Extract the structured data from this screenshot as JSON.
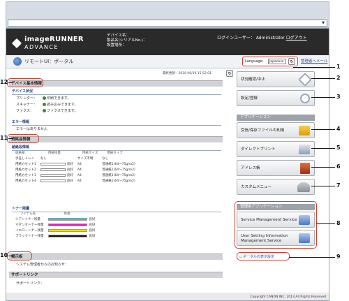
{
  "header": {
    "logo_line1": "imageRUNNER",
    "logo_line2": "ADVANCE",
    "device_name_label": "デバイス名：",
    "serial_label": "製品名(シリアルNo.)：",
    "location_label": "設置場所：",
    "login_user_label": "ログインユーザー：",
    "login_user": "Administrator",
    "logout": "ログアウト"
  },
  "titlebar": {
    "title": "リモートUI：ポータル",
    "language_label": "Language:",
    "language_value": "Japanese",
    "help_link": "管理者へメール"
  },
  "updated": "最終更新：2018 06/19 15:52:01",
  "sections": {
    "device_basic": "デバイス基本情報",
    "device_status": "デバイス状況",
    "status_rows": [
      {
        "label": "プリンター：",
        "value": "印刷できます。"
      },
      {
        "label": "スキャナー：",
        "value": "読み込みできます。"
      },
      {
        "label": "ファクス：",
        "value": "ファクスできます。"
      }
    ],
    "error_title": "エラー情報",
    "error_text": "エラーはありません",
    "consumables": "消耗品情報",
    "paper_title": "給紙段情報",
    "paper_headers": [
      "給紙部",
      "用紙残量",
      "用紙サイズ",
      "用紙タイプ"
    ],
    "paper_rows": [
      {
        "slot": "手差しトレイ",
        "remain": "なし",
        "size": "サイズ不明",
        "type": "なし"
      },
      {
        "slot": "用紙カセット1",
        "remain": "良好",
        "size": "A4",
        "type": "普通紙1(64～75g/m2)"
      },
      {
        "slot": "用紙カセット2",
        "remain": "良好",
        "size": "A4",
        "type": "普通紙1(64～75g/m2)"
      },
      {
        "slot": "用紙カセット3",
        "remain": "良好",
        "size": "A4",
        "type": "普通紙1(64～75g/m2)"
      },
      {
        "slot": "用紙カセット4",
        "remain": "良好",
        "size": "A4",
        "type": "普通紙1(64～75g/m2)"
      }
    ],
    "toner_title": "トナー残量",
    "toner_headers": [
      "アイテム名",
      "残量"
    ],
    "toner_rows": [
      {
        "name": "シアントナー残量",
        "state": "良好",
        "color": "#00d0e8"
      },
      {
        "name": "マゼンタトナー残量",
        "state": "良好",
        "color": "#e020c0"
      },
      {
        "name": "イエロートナー残量",
        "state": "良好",
        "color": "#f0e000"
      },
      {
        "name": "ブラックトナー残量",
        "state": "良好",
        "color": "#111111"
      }
    ],
    "message_board": "掲示板",
    "message_text": "システム管理者からのお知らせ：",
    "support": "サポートリンク",
    "support_text": "サポートリンク："
  },
  "right": {
    "status_button": "状況確認/中止",
    "settings_button": "設定/登録",
    "apps_header": "アプリケーション",
    "app_buttons": [
      "受信/保存ファイルの利用",
      "ダイレクトプリント",
      "アドレス帳",
      "カスタムメニュー"
    ],
    "mgmt_header": "管理用アプリケーション",
    "mgmt_buttons": [
      "Service Management Service",
      "User Setting Information\nManagement Service"
    ],
    "portal_settings": "ポータルの表示設定"
  },
  "callouts": [
    "1",
    "2",
    "3",
    "4",
    "5",
    "6",
    "7",
    "8",
    "9",
    "10",
    "11",
    "12"
  ],
  "footer": "Copyright CANON INC. 2013 All Rights Reserved",
  "colors": {
    "accent_red": "#d04030",
    "header_bg": "#2a2a2a",
    "section_bg": "#d0d2d6"
  }
}
